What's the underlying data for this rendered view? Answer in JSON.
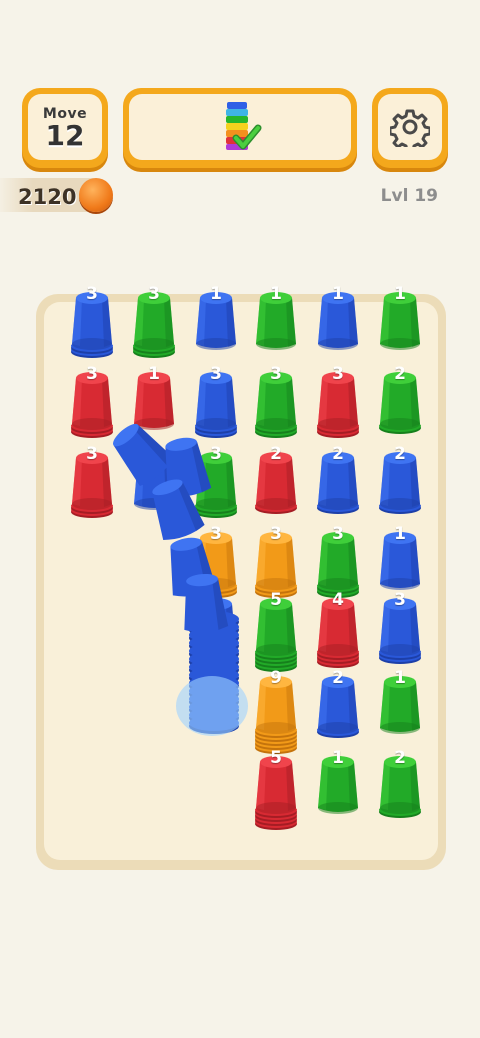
{
  "hud": {
    "move_label": "Move",
    "move_value": "12",
    "coins": "2120",
    "level": "Lvl 19"
  },
  "icons": {
    "goal": "rainbow-cup-stack-check-icon",
    "settings": "gear-icon",
    "coin": "coin-icon"
  },
  "colors": {
    "blue": "#2f5fe6",
    "green": "#27b52c",
    "red": "#e0323a",
    "orange": "#f4a01e",
    "hud_accent": "#f4a81c"
  },
  "board": {
    "columns": 6,
    "rows": [
      [
        {
          "color": "blue",
          "count": "3"
        },
        {
          "color": "green",
          "count": "3"
        },
        {
          "color": "blue",
          "count": "1"
        },
        {
          "color": "green",
          "count": "1"
        },
        {
          "color": "blue",
          "count": "1"
        },
        {
          "color": "green",
          "count": "1"
        }
      ],
      [
        {
          "color": "red",
          "count": "3"
        },
        {
          "color": "red",
          "count": "1"
        },
        {
          "color": "blue",
          "count": "3"
        },
        {
          "color": "green",
          "count": "3"
        },
        {
          "color": "red",
          "count": "3"
        },
        {
          "color": "green",
          "count": "2"
        }
      ],
      [
        {
          "color": "red",
          "count": "3"
        },
        {
          "color": "blue",
          "count": ""
        },
        {
          "color": "green",
          "count": "3"
        },
        {
          "color": "red",
          "count": "2"
        },
        {
          "color": "blue",
          "count": "2"
        },
        {
          "color": "blue",
          "count": "2"
        }
      ],
      [
        null,
        null,
        {
          "color": "orange",
          "count": "3"
        },
        {
          "color": "orange",
          "count": "3"
        },
        {
          "color": "green",
          "count": "3"
        },
        {
          "color": "blue",
          "count": "1"
        }
      ],
      [
        null,
        null,
        {
          "color": "blue",
          "count": ""
        },
        {
          "color": "green",
          "count": "5"
        },
        {
          "color": "red",
          "count": "4"
        },
        {
          "color": "blue",
          "count": "3"
        }
      ],
      [
        null,
        null,
        {
          "color": "blue",
          "count": ""
        },
        {
          "color": "orange",
          "count": "9"
        },
        {
          "color": "blue",
          "count": "2"
        },
        {
          "color": "green",
          "count": "1"
        }
      ],
      [
        null,
        null,
        null,
        {
          "color": "red",
          "count": "5"
        },
        {
          "color": "green",
          "count": "1"
        },
        {
          "color": "green",
          "count": "2"
        }
      ]
    ]
  }
}
